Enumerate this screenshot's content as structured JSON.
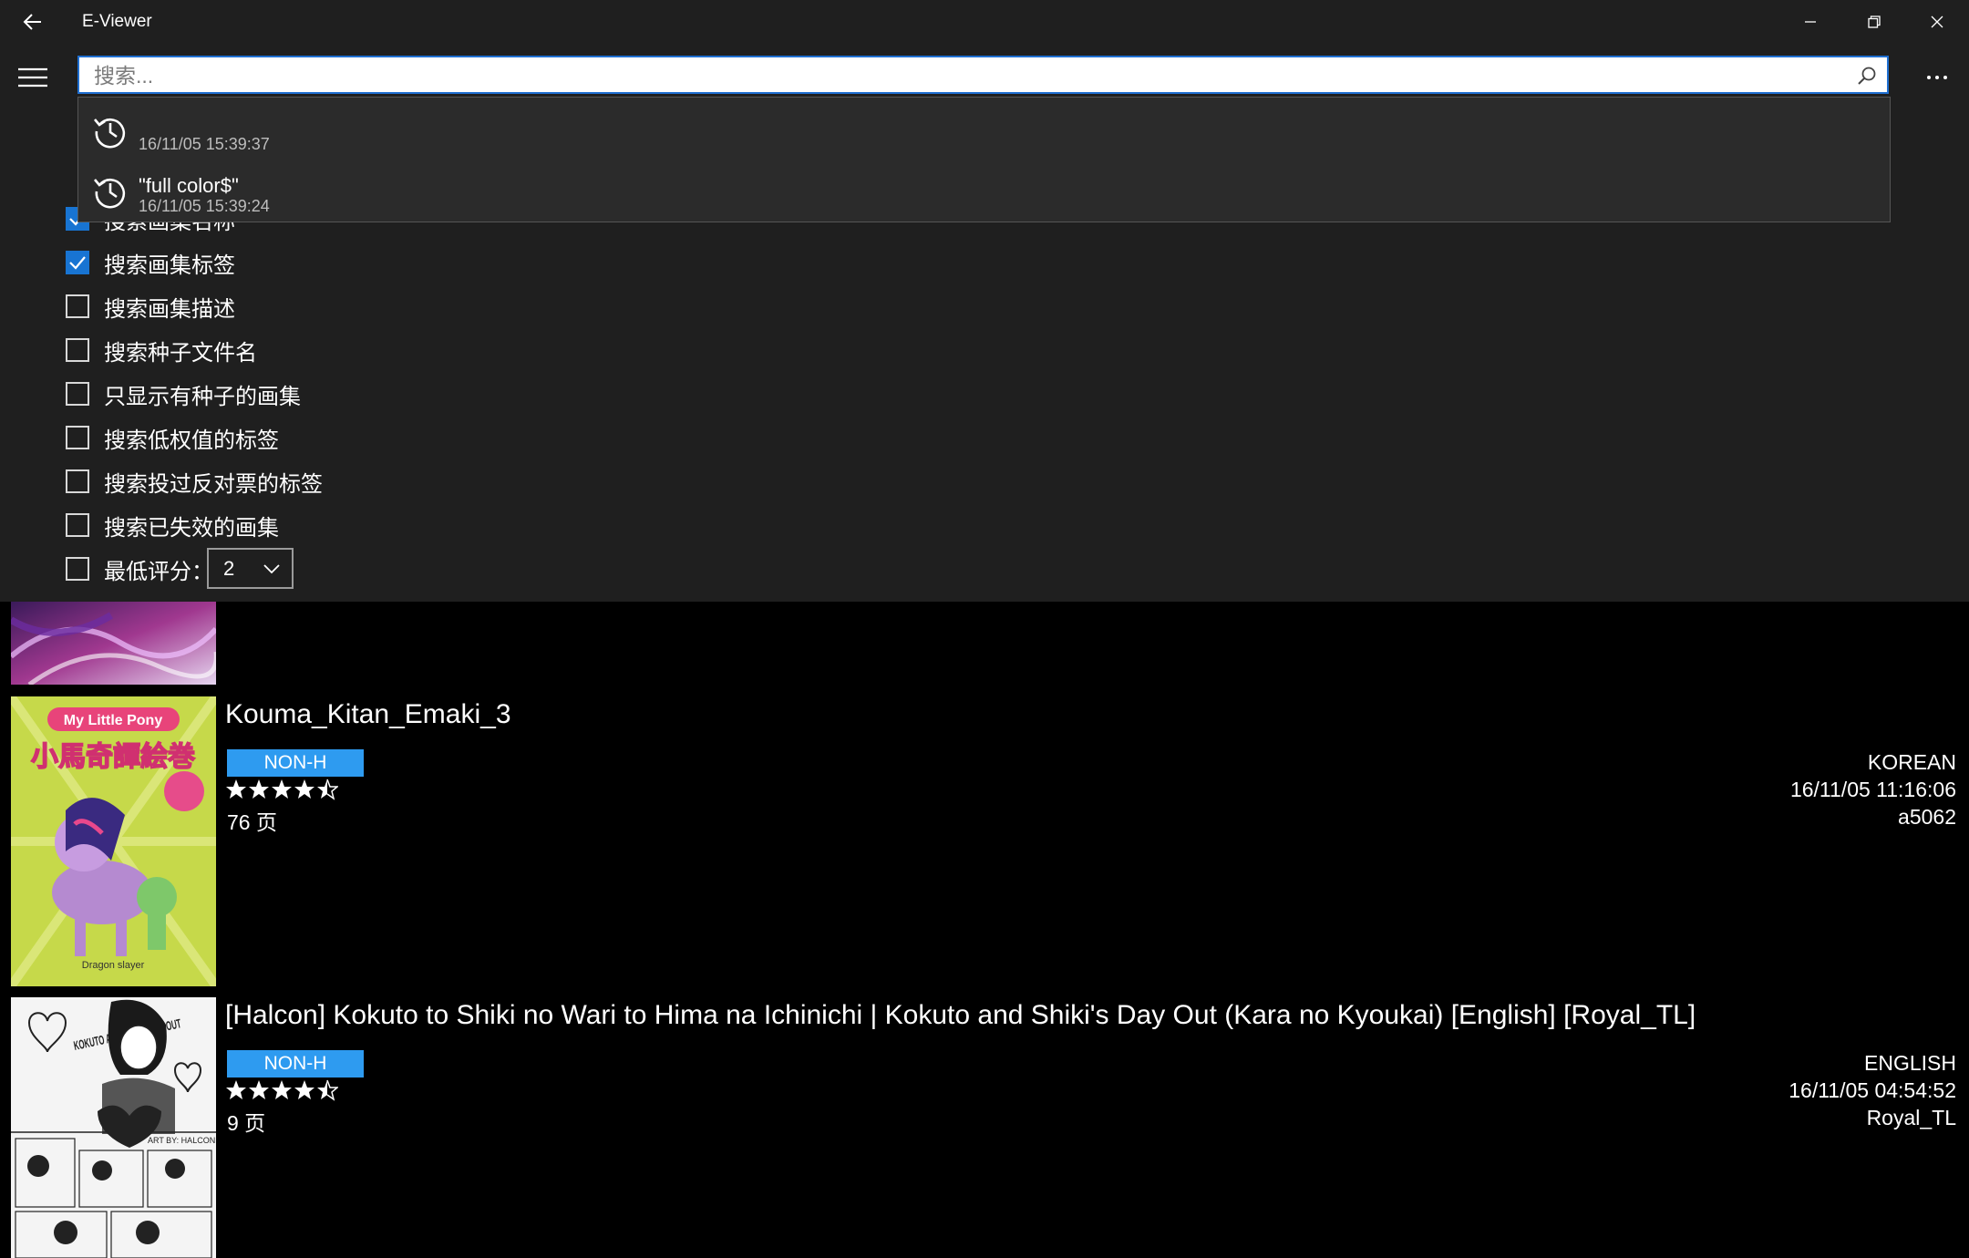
{
  "app": {
    "title": "E-Viewer"
  },
  "search": {
    "placeholder": "搜索...",
    "value": ""
  },
  "suggestions": [
    {
      "text": "",
      "time": "16/11/05 15:39:37"
    },
    {
      "text": "\"full color$\"",
      "time": "16/11/05 15:39:24"
    }
  ],
  "options": {
    "items": [
      {
        "label": "搜索画集名称",
        "checked": true
      },
      {
        "label": "搜索画集标签",
        "checked": true
      },
      {
        "label": "搜索画集描述",
        "checked": false
      },
      {
        "label": "搜索种子文件名",
        "checked": false
      },
      {
        "label": "只显示有种子的画集",
        "checked": false
      },
      {
        "label": "搜索低权值的标签",
        "checked": false
      },
      {
        "label": "搜索投过反对票的标签",
        "checked": false
      },
      {
        "label": "搜索已失效的画集",
        "checked": false
      }
    ],
    "min_rating": {
      "label": "最低评分：",
      "checked": false,
      "value": "2"
    }
  },
  "galleries": [
    {
      "title": "Kouma_Kitan_Emaki_3",
      "category": "NON-H",
      "rating": 4.5,
      "pages": "76 页",
      "language": "KOREAN",
      "posted": "16/11/05 11:16:06",
      "uploader": "a5062",
      "cover": {
        "top_text": "My Little Pony",
        "jp_title": "小馬奇譚絵巻",
        "bottom_text": "Dragon slayer"
      }
    },
    {
      "title": "[Halcon] Kokuto to Shiki no Wari to Hima na Ichinichi | Kokuto and Shiki's Day Out (Kara no Kyoukai) [English] [Royal_TL]",
      "category": "NON-H",
      "rating": 4.5,
      "pages": "9 页",
      "language": "ENGLISH",
      "posted": "16/11/05 04:54:52",
      "uploader": "Royal_TL",
      "cover": {
        "top_text": "KOKUTO AND SHIKI'S DAY OUT",
        "credit": "ART BY: HALCON"
      }
    }
  ],
  "colors": {
    "accent": "#1874d2",
    "badge": "#2e9bf0",
    "panel": "#1f1f1f"
  }
}
